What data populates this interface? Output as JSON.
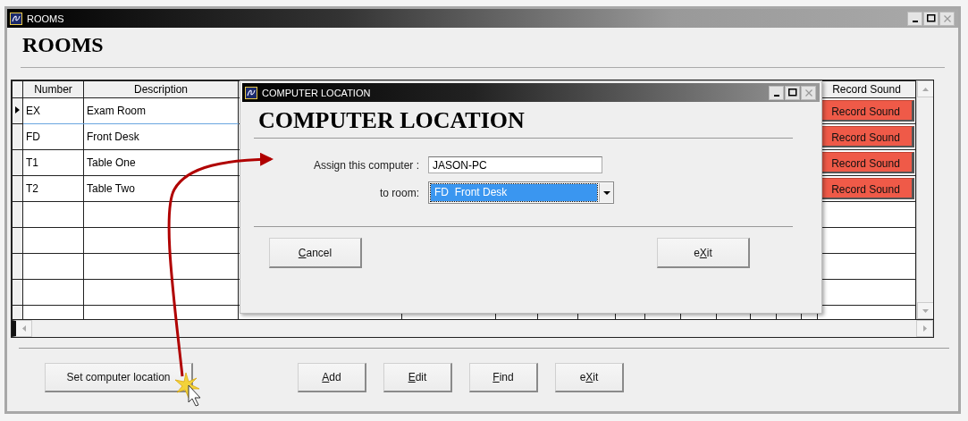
{
  "window": {
    "title": "ROOMS",
    "heading": "ROOMS"
  },
  "table": {
    "columns": [
      "Number",
      "Description",
      "Record Sound"
    ],
    "rows": [
      {
        "number": "EX",
        "description": "Exam Room",
        "action": "Record Sound",
        "selected": true
      },
      {
        "number": "FD",
        "description": "Front Desk",
        "action": "Record Sound",
        "selected": false
      },
      {
        "number": "T1",
        "description": "Table One",
        "action": "Record Sound",
        "selected": false
      },
      {
        "number": "T2",
        "description": "Table Two",
        "action": "Record Sound",
        "selected": false
      }
    ]
  },
  "buttons": [
    {
      "kind": "plain",
      "label": "Set computer location"
    },
    {
      "kind": "hotkey",
      "key": "A",
      "post": "dd"
    },
    {
      "kind": "hotkey",
      "key": "E",
      "post": "dit"
    },
    {
      "kind": "hotkey",
      "key": "F",
      "post": "ind"
    },
    {
      "kind": "hotkey",
      "pre": "e",
      "key": "X",
      "post": "it"
    }
  ],
  "dialog": {
    "title": "COMPUTER LOCATION",
    "heading": "COMPUTER LOCATION",
    "fields": [
      {
        "kind": "text",
        "label": "Assign this computer :",
        "value": "JASON-PC"
      },
      {
        "kind": "dropdown",
        "label": "to room:",
        "value": "FD  Front Desk",
        "focused": true
      }
    ],
    "buttons": [
      {
        "kind": "hotkey",
        "key": "C",
        "post": "ancel"
      },
      {
        "kind": "hotkey",
        "pre": "e",
        "key": "X",
        "post": "it"
      }
    ]
  }
}
